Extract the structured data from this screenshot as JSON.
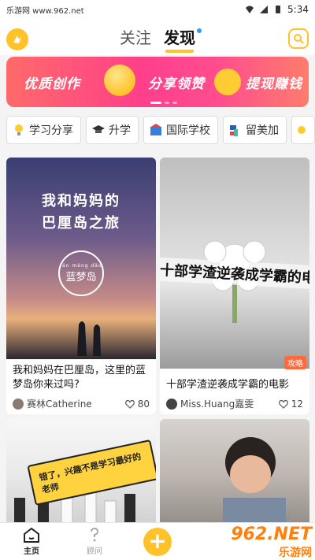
{
  "statusbar": {
    "watermark": "乐游网 www.962.net",
    "time": "5:34"
  },
  "header": {
    "tabs": [
      {
        "label": "关注"
      },
      {
        "label": "发现"
      }
    ]
  },
  "banner": {
    "items": [
      "优质创作",
      "分享领赞",
      "提现赚钱"
    ],
    "dot_count": 3,
    "active_dot": 0
  },
  "chips": [
    {
      "label": "学习分享",
      "icon": "lightbulb-icon"
    },
    {
      "label": "升学",
      "icon": "graduation-cap-icon"
    },
    {
      "label": "国际学校",
      "icon": "school-building-icon"
    },
    {
      "label": "留美加",
      "icon": "statue-of-liberty-icon"
    }
  ],
  "feed": [
    {
      "cover_title": "我和妈妈的\n巴厘岛之旅",
      "cover_badge": "蓝梦岛",
      "cover_badge_pinyin": "lán mèng dǎo",
      "title": "我和妈妈在巴厘岛，这里的蓝梦岛你来过吗?",
      "author": "赛林Catherine",
      "likes": "80"
    },
    {
      "cover_overlay": "十部学渣逆袭成学霸的电",
      "tag": "攻略",
      "title": "十部学渣逆袭成学霸的电影",
      "author": "Miss.Huang嘉雯",
      "likes": "12"
    },
    {
      "cover_overlay": "错了，兴趣不是学习最好的老师"
    },
    {}
  ],
  "tabbar": {
    "items": [
      {
        "label": "主页",
        "icon": "home-icon"
      },
      {
        "label": "顾问",
        "icon": "question-icon"
      },
      {
        "label": "",
        "icon": "plus-icon"
      }
    ]
  },
  "watermark": {
    "top": "962.NET",
    "bottom": "乐游网"
  },
  "colors": {
    "accent": "#ffc229",
    "banner_start": "#ff6a6a",
    "banner_end": "#ff7c6b"
  }
}
